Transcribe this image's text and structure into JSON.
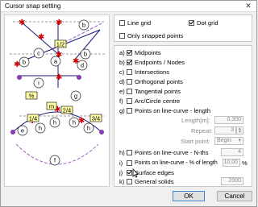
{
  "window": {
    "title": "Cursor snap setting",
    "close_glyph": "✕"
  },
  "preview": {
    "labels": {
      "b_top": "b",
      "half": "1/2",
      "b_right": "b",
      "c": "c",
      "a": "a",
      "d": "d",
      "b_left": "b",
      "i": "i",
      "percent": "%",
      "m": "m",
      "g": "g",
      "quarter1": "1/4",
      "twoquarters": "2/4",
      "threequarters": "3/4",
      "e": "e",
      "h1": "h",
      "h2": "h",
      "h3": "h",
      "h4": "h",
      "f": "f"
    }
  },
  "grid": {
    "line_grid": {
      "label": "Line grid",
      "checked": false
    },
    "dot_grid": {
      "label": "Dot grid",
      "checked": true
    },
    "only_snapped": {
      "label": "Only snapped points",
      "checked": false
    }
  },
  "options": [
    {
      "prefix": "a)",
      "label": "Midpoints",
      "checked": true
    },
    {
      "prefix": "b)",
      "label": "Endpoints / Nodes",
      "checked": true
    },
    {
      "prefix": "c)",
      "label": "Intersections",
      "checked": false
    },
    {
      "prefix": "d)",
      "label": "Orthogonal points",
      "checked": false
    },
    {
      "prefix": "e)",
      "label": "Tangential points",
      "checked": false
    },
    {
      "prefix": "f)",
      "label": "Arc/Circle centre",
      "checked": false
    },
    {
      "prefix": "g)",
      "label": "Points on line-curve - length",
      "checked": false
    }
  ],
  "length_settings": {
    "length_label": "Length[m]:",
    "length_value": "0,300",
    "repeat_label": "Repeat:",
    "repeat_value": "3",
    "start_label": "Start point:",
    "start_value": "Begin"
  },
  "options2": [
    {
      "prefix": "h)",
      "label": "Points on line-curve - N-ths",
      "value": "4",
      "checked": false
    },
    {
      "prefix": "i)",
      "label": "Points on line-curve - % of length",
      "value": "10,00",
      "unit": "%",
      "checked": false
    },
    {
      "prefix": "j)",
      "label": "Surface edges",
      "checked": true
    },
    {
      "prefix": "k)",
      "label": "General solids",
      "value": "2000",
      "checked": false
    }
  ],
  "buttons": {
    "ok": "OK",
    "cancel": "Cancel"
  }
}
